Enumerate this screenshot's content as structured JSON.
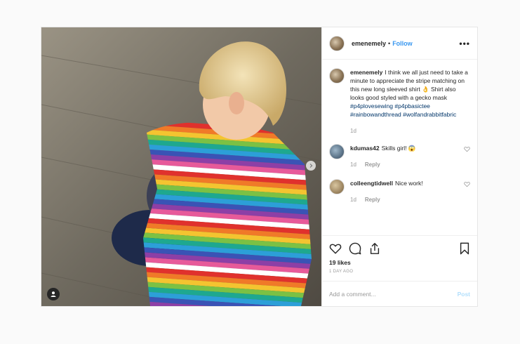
{
  "post": {
    "username": "emenemely",
    "separator": "•",
    "follow_label": "Follow",
    "more_glyph": "•••",
    "caption": {
      "username": "emenemely",
      "text": "I think we all just need to take a minute to appreciate the stripe matching on this new long sleeved shirt 👌 Shirt also looks good styled with a gecko mask",
      "hashtags": [
        "#p4plovesewing",
        "#p4pbasictee",
        "#rainbowandthread",
        "#wolfandrabbitfabric"
      ],
      "time": "1d"
    },
    "comments": [
      {
        "username": "kdumas42",
        "text": "Skills girl! 😱",
        "time": "1d",
        "reply_label": "Reply"
      },
      {
        "username": "colleengtidwell",
        "text": "Nice work!",
        "time": "1d",
        "reply_label": "Reply"
      }
    ],
    "likes": "19 likes",
    "posted_ago": "1 DAY AGO",
    "add_comment_placeholder": "Add a comment...",
    "post_button_label": "Post"
  },
  "icons": {
    "like": "heart-icon",
    "comment": "comment-icon",
    "share": "share-icon",
    "save": "bookmark-icon",
    "tag": "user-tag-icon",
    "next": "chevron-right-icon"
  },
  "colors": {
    "link": "#3897f0",
    "hashtag": "#003569",
    "post_disabled": "#b2dffc"
  }
}
